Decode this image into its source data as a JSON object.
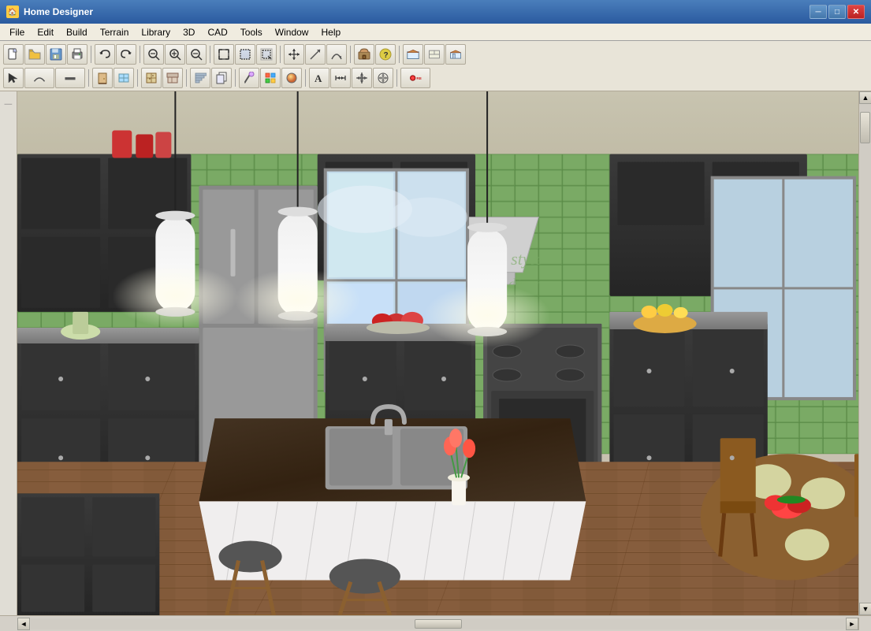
{
  "titleBar": {
    "title": "Home Designer",
    "icon": "🏠",
    "controls": {
      "minimize": "─",
      "maximize": "□",
      "close": "✕"
    }
  },
  "menuBar": {
    "items": [
      {
        "id": "file",
        "label": "File"
      },
      {
        "id": "edit",
        "label": "Edit"
      },
      {
        "id": "build",
        "label": "Build"
      },
      {
        "id": "terrain",
        "label": "Terrain"
      },
      {
        "id": "library",
        "label": "Library"
      },
      {
        "id": "3d",
        "label": "3D"
      },
      {
        "id": "cad",
        "label": "CAD"
      },
      {
        "id": "tools",
        "label": "Tools"
      },
      {
        "id": "window",
        "label": "Window"
      },
      {
        "id": "help",
        "label": "Help"
      }
    ]
  },
  "toolbar1": {
    "buttons": [
      {
        "id": "new",
        "icon": "📄",
        "tooltip": "New"
      },
      {
        "id": "open",
        "icon": "📂",
        "tooltip": "Open"
      },
      {
        "id": "save",
        "icon": "💾",
        "tooltip": "Save"
      },
      {
        "id": "print",
        "icon": "🖨",
        "tooltip": "Print"
      },
      {
        "id": "undo",
        "icon": "↩",
        "tooltip": "Undo"
      },
      {
        "id": "redo",
        "icon": "↪",
        "tooltip": "Redo"
      },
      {
        "id": "zoom-out-fit",
        "icon": "⊟",
        "tooltip": "Zoom to Fit"
      },
      {
        "id": "zoom-in",
        "icon": "⊕",
        "tooltip": "Zoom In"
      },
      {
        "id": "zoom-out",
        "icon": "⊖",
        "tooltip": "Zoom Out"
      },
      {
        "id": "fill-window",
        "icon": "⛶",
        "tooltip": "Fill Window"
      },
      {
        "id": "select-region",
        "icon": "▣",
        "tooltip": "Select Region"
      },
      {
        "id": "hand",
        "icon": "✋",
        "tooltip": "Hand"
      },
      {
        "id": "draw-line",
        "icon": "╱",
        "tooltip": "Draw Line"
      },
      {
        "id": "arrow",
        "icon": "↑",
        "tooltip": "Arrow"
      },
      {
        "id": "arc",
        "icon": "⌒",
        "tooltip": "Arc"
      },
      {
        "id": "object-library",
        "icon": "📦",
        "tooltip": "Object Library"
      },
      {
        "id": "help",
        "icon": "?",
        "tooltip": "Help"
      },
      {
        "id": "wall-elev",
        "icon": "🏠",
        "tooltip": "Wall Elevation"
      },
      {
        "id": "floor-plan",
        "icon": "⊞",
        "tooltip": "Floor Plan"
      },
      {
        "id": "house",
        "icon": "🏡",
        "tooltip": "3D View"
      }
    ]
  },
  "toolbar2": {
    "buttons": [
      {
        "id": "select",
        "icon": "↖",
        "tooltip": "Select Objects"
      },
      {
        "id": "curve",
        "icon": "∫",
        "tooltip": "Curved Wall"
      },
      {
        "id": "wall",
        "icon": "⊢",
        "tooltip": "Straight Wall"
      },
      {
        "id": "door",
        "icon": "🚪",
        "tooltip": "Door"
      },
      {
        "id": "window",
        "icon": "⬜",
        "tooltip": "Window"
      },
      {
        "id": "stairs",
        "icon": "⬛",
        "tooltip": "Stairs"
      },
      {
        "id": "cabinet",
        "icon": "⬛",
        "tooltip": "Cabinet"
      },
      {
        "id": "copy-paste",
        "icon": "📋",
        "tooltip": "Copy/Paste"
      },
      {
        "id": "eyedropper",
        "icon": "💧",
        "tooltip": "Color Eyedropper"
      },
      {
        "id": "material",
        "icon": "🎨",
        "tooltip": "Material Painter"
      },
      {
        "id": "text",
        "icon": "A",
        "tooltip": "Text"
      },
      {
        "id": "dimension",
        "icon": "↔",
        "tooltip": "Dimension"
      },
      {
        "id": "move",
        "icon": "✛",
        "tooltip": "Move"
      },
      {
        "id": "rotate",
        "icon": "↻",
        "tooltip": "Rotate"
      },
      {
        "id": "record",
        "icon": "⏺",
        "tooltip": "Record"
      }
    ]
  },
  "canvas": {
    "description": "3D Kitchen Render",
    "scene": "kitchen_3d_view"
  },
  "scrollbars": {
    "vertical": {
      "arrowUp": "▲",
      "arrowDown": "▼"
    },
    "horizontal": {
      "arrowLeft": "◄",
      "arrowRight": "►"
    }
  }
}
